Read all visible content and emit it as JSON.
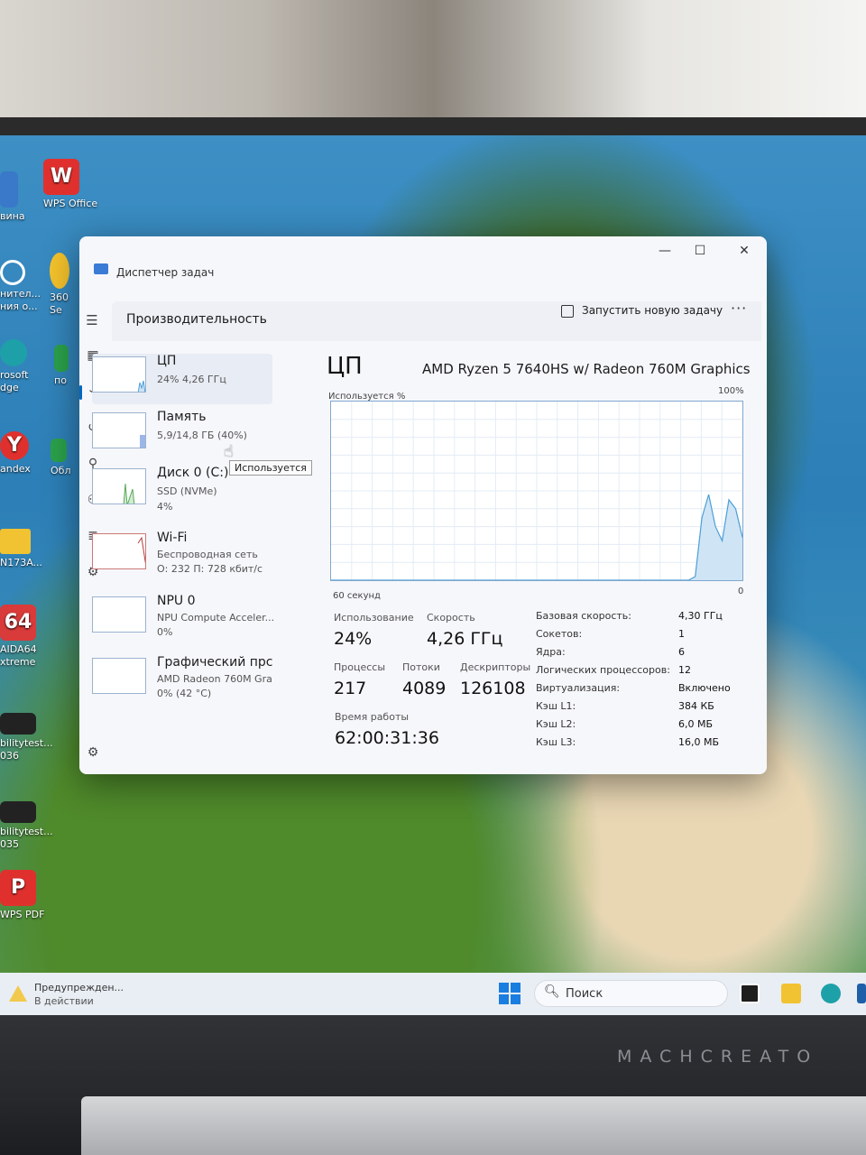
{
  "brand": "MACHCREATO",
  "desktop_icons": [
    {
      "label": "вина"
    },
    {
      "label": "WPS Office"
    },
    {
      "label": "нител... ния о..."
    },
    {
      "label": "360 Se"
    },
    {
      "label": "rosoft dge"
    },
    {
      "label": "по"
    },
    {
      "label": "andex"
    },
    {
      "label": "Обл"
    },
    {
      "label": "N173A..."
    },
    {
      "label": "AIDA64 xtreme"
    },
    {
      "label": "bilitytest... 036"
    },
    {
      "label": "bilitytest... 035"
    },
    {
      "label": "WPS PDF"
    }
  ],
  "window": {
    "title": "Диспетчер задач",
    "section_title": "Производительность",
    "run_task": "Запустить новую задачу",
    "more": "···",
    "minimize": "—",
    "maximize": "☐",
    "close": "✕"
  },
  "nav_icons": [
    "hamburger-icon",
    "processes-icon",
    "performance-icon",
    "history-icon",
    "startup-icon",
    "users-icon",
    "details-icon",
    "services-icon",
    "settings-icon"
  ],
  "devices": [
    {
      "name": "ЦП",
      "sub1": "24% 4,26 ГГц",
      "sub2": ""
    },
    {
      "name": "Память",
      "sub1": "5,9/14,8 ГБ (40%)",
      "sub2": ""
    },
    {
      "name": "Диск 0 (C:)",
      "sub1": "SSD (NVMe)",
      "sub2": "4%"
    },
    {
      "name": "Wi-Fi",
      "sub1": "Беспроводная сеть",
      "sub2": "О: 232 П: 728 кбит/с"
    },
    {
      "name": "NPU 0",
      "sub1": "NPU Compute Acceler...",
      "sub2": "0%"
    },
    {
      "name": "Графический прс",
      "sub1": "AMD Radeon 760M Gra",
      "sub2": "0% (42 °C)"
    }
  ],
  "tooltip": "Используется",
  "cpu_panel": {
    "title": "ЦП",
    "model": "AMD Ryzen 5 7640HS w/ Radeon 760M Graphics",
    "util_label": "Используется %",
    "max_label": "100%",
    "time_label": "60 секунд",
    "zero_label": "0",
    "stats": {
      "usage_label": "Использование",
      "usage": "24%",
      "speed_label": "Скорость",
      "speed": "4,26 ГГц",
      "processes_label": "Процессы",
      "processes": "217",
      "threads_label": "Потоки",
      "threads": "4089",
      "handles_label": "Дескрипторы",
      "handles": "126108",
      "uptime_label": "Время работы",
      "uptime": "62:00:31:36"
    },
    "specs": [
      {
        "key": "Базовая скорость:",
        "value": "4,30 ГГц"
      },
      {
        "key": "Сокетов:",
        "value": "1"
      },
      {
        "key": "Ядра:",
        "value": "6"
      },
      {
        "key": "Логических процессоров:",
        "value": "12"
      },
      {
        "key": "Виртуализация:",
        "value": "Включено"
      },
      {
        "key": "Кэш L1:",
        "value": "384 КБ"
      },
      {
        "key": "Кэш L2:",
        "value": "6,0 МБ"
      },
      {
        "key": "Кэш L3:",
        "value": "16,0 МБ"
      }
    ]
  },
  "chart_data": {
    "type": "area",
    "xlabel": "60 секунд",
    "ylabel": "Используется %",
    "ylim": [
      0,
      100
    ],
    "values": [
      0,
      0,
      0,
      0,
      0,
      0,
      0,
      0,
      0,
      0,
      0,
      0,
      0,
      0,
      0,
      0,
      0,
      0,
      0,
      0,
      0,
      0,
      0,
      0,
      0,
      0,
      0,
      0,
      0,
      0,
      0,
      0,
      0,
      0,
      0,
      0,
      0,
      0,
      0,
      0,
      0,
      0,
      0,
      0,
      0,
      0,
      0,
      0,
      0,
      0,
      0,
      0,
      0,
      0,
      2,
      35,
      48,
      30,
      22,
      45,
      40,
      24
    ]
  },
  "taskbar": {
    "warning_title": "Предупрежден...",
    "warning_sub": "В действии",
    "search_placeholder": "Поиск"
  },
  "colors": {
    "accent": "#0067c0",
    "graph_line": "#4b9fd8",
    "graph_fill": "#cfe5f5"
  }
}
